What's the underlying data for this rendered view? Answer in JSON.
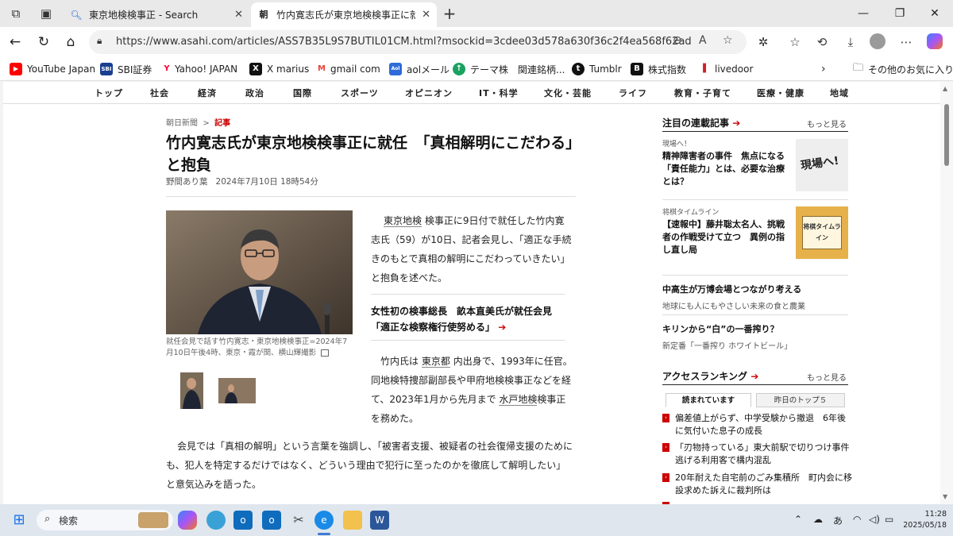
{
  "browser": {
    "tabs": [
      {
        "icon": "search-icon",
        "label": "東京地検検事正 - Search",
        "active": false
      },
      {
        "icon": "asahi-icon",
        "label": "竹内寛志氏が東京地検検事正に就任",
        "active": true,
        "favicon_text": "朝"
      }
    ],
    "url": "https://www.asahi.com/articles/ASS7B35L9S7BUTIL01CM.html?msockid=3cdee03d578a630f36c2f4ea568f62ad"
  },
  "bookmarks": [
    {
      "label": "YouTube Japan",
      "icon": "youtube-icon",
      "color": "#ff0000",
      "glyph": "▶"
    },
    {
      "label": "SBI証券",
      "icon": "sbi-icon",
      "color": "#1a3f8f",
      "glyph": "SBI"
    },
    {
      "label": "Yahoo! JAPAN",
      "icon": "yahoo-icon",
      "color": "#ff0033",
      "glyph": "Y"
    },
    {
      "label": "X marius",
      "icon": "x-icon",
      "color": "#111111",
      "glyph": "X"
    },
    {
      "label": "gmail com",
      "icon": "gmail-icon",
      "color": "#ea4335",
      "glyph": "M"
    },
    {
      "label": "aolメール",
      "icon": "aol-icon",
      "color": "#2f6bd8",
      "glyph": "Aol"
    },
    {
      "label": "テーマ株　関連銘柄...",
      "icon": "kabutan-icon",
      "color": "#1aa260",
      "glyph": "↑"
    },
    {
      "label": "Tumblr",
      "icon": "tumblr-icon",
      "color": "#111111",
      "glyph": "t"
    },
    {
      "label": "株式指数",
      "icon": "b-icon",
      "color": "#111111",
      "glyph": "B"
    },
    {
      "label": "livedoor",
      "icon": "livedoor-icon",
      "color": "#d0202a",
      "glyph": "▌"
    }
  ],
  "other_favorites": "その他のお気に入り",
  "categories": [
    "トップ",
    "社会",
    "経済",
    "政治",
    "国際",
    "スポーツ",
    "オピニオン",
    "IT・科学",
    "文化・芸能",
    "ライフ",
    "教育・子育て",
    "医療・健康",
    "地域"
  ],
  "article": {
    "breadcrumb_home": "朝日新聞",
    "breadcrumb_sep": ">",
    "breadcrumb_current": "記事",
    "headline": "竹内寛志氏が東京地検検事正に就任　「真相解明にこだわる」と抱負",
    "author": "野間あり葉",
    "datetime": "2024年7月10日 18時54分",
    "photo_caption": "就任会見で話す竹内寛志・東京地検検事正=2024年7月10日午後4時、東京・霞が関、横山輝撮影",
    "p1_kw": "東京地検",
    "p1_rest": "検事正に9日付で就任した竹内寛志氏（59）が10日、記者会見し、「適正な手続きのもとで真相の解明にこだわっていきたい」と抱負を述べた。",
    "related_link": "女性初の検事総長　畝本直美氏が就任会見「適正な検察権行使努める」",
    "p2_a": "竹内氏は",
    "p2_kw1": "東京都",
    "p2_b": "内出身で、1993年に任官。同地検特捜部副部長や甲府地検検事正などを経て、2023年1月から先月まで",
    "p2_kw2": "水戸地検",
    "p2_c": "検事正を務めた。",
    "p3": "会見では「真相の解明」という言葉を強調し、「被害者支援、被疑者の社会復帰支援のためにも、犯人を特定するだけではなく、どういう理由で犯行に至ったのかを徹底して解明したい」と意気込みを語った。"
  },
  "sidebar": {
    "serial_head": "注目の連載記事",
    "more1": "もっと見る",
    "item1_kicker": "現場へ！",
    "item1_title": "精神障害者の事件　焦点になる「責任能力」とは、必要な治療とは？",
    "item1_img_text": "現場へ!",
    "item2_kicker": "将棋タイムライン",
    "item2_title": "【速報中】藤井聡太名人、挑戦者の作戦受けて立つ　異例の指し直し局",
    "item2_img_text": "将棋タイムライン",
    "promo1_title": "中高生が万博会場とつながり考える",
    "promo1_sub": "地球にも人にもやさしい未来の食と農業",
    "promo2_title": "キリンから“白”の一番搾り？",
    "promo2_sub": "新定番「一番搾り ホワイトビール」",
    "ranking_head": "アクセスランキング",
    "more2": "もっと見る",
    "rank_tabs": [
      "読まれています",
      "昨日のトップ５"
    ],
    "ranking": [
      "偏差値上がらず、中学受験から撤退　6年後に気付いた息子の成長",
      "「刃物持っている」東大前駅で切りつけ事件　逃げる利用客で構内混乱",
      "20年耐えた自宅前のごみ集積所　町内会に移設求めた訴えに裁判所は"
    ]
  },
  "taskbar": {
    "search_placeholder": "検索",
    "ime": "あ",
    "time": "11:28",
    "date": "2025/05/18"
  }
}
